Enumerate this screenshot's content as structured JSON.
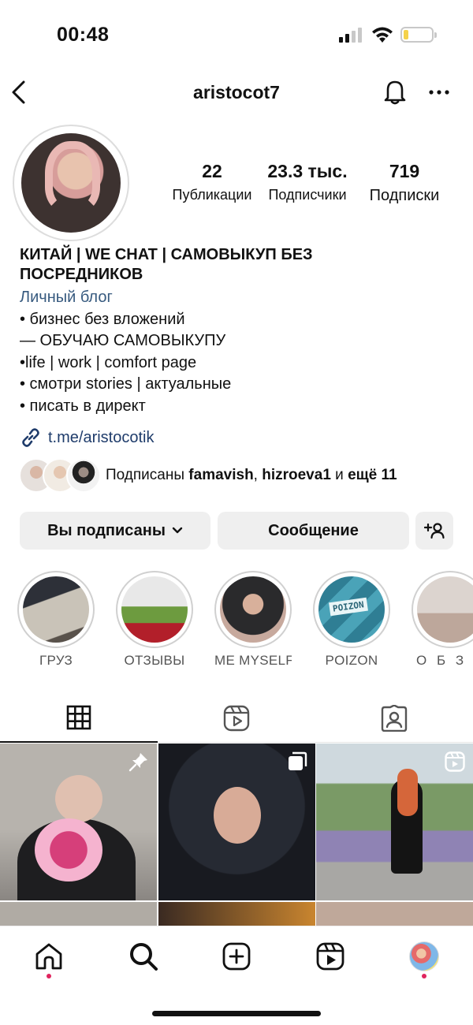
{
  "status_bar": {
    "time": "00:48"
  },
  "header": {
    "username": "aristocot7"
  },
  "profile": {
    "stats": [
      {
        "value": "22",
        "label": "Публикации"
      },
      {
        "value": "23.3 тыс.",
        "label": "Подписчики"
      },
      {
        "value": "719",
        "label": "Подписки"
      }
    ],
    "bio": {
      "name_line1": "КИТАЙ | WE CHAT | САМОВЫКУП БЕЗ",
      "name_line2": "ПОСРЕДНИКОВ",
      "category": "Личный блог",
      "lines": [
        "• бизнес без вложений",
        "— ОБУЧАЮ САМОВЫКУПУ",
        "•life | work | comfort page",
        "• смотри stories | актуальные",
        "• писать в директ"
      ]
    },
    "link": "t.me/aristocotik",
    "followed_by": {
      "prefix": "Подписаны ",
      "user1": "famavish",
      "sep": ", ",
      "user2": "hizroeva1",
      "middle": " и ",
      "more": "ещё 11"
    }
  },
  "buttons": {
    "following": "Вы подписаны",
    "message": "Сообщение"
  },
  "highlights": [
    {
      "label": "ГРУЗ"
    },
    {
      "label": "ОТЗЫВЫ"
    },
    {
      "label": "ME MYSELF..."
    },
    {
      "label": "POIZON"
    },
    {
      "label": "О Б З О"
    }
  ],
  "highlight_poizon_tag": "POIZON",
  "tabs": [
    "grid",
    "reels",
    "tagged"
  ],
  "colors": {
    "link_blue": "#1f3c6b",
    "category_blue": "#375a7f",
    "button_bg": "#efefef",
    "notification_dot": "#e0245e"
  },
  "icons": {
    "header": [
      "back-icon",
      "bell-icon",
      "more-icon"
    ],
    "nav": [
      "home-icon",
      "search-icon",
      "create-icon",
      "reels-icon",
      "profile-avatar"
    ]
  }
}
